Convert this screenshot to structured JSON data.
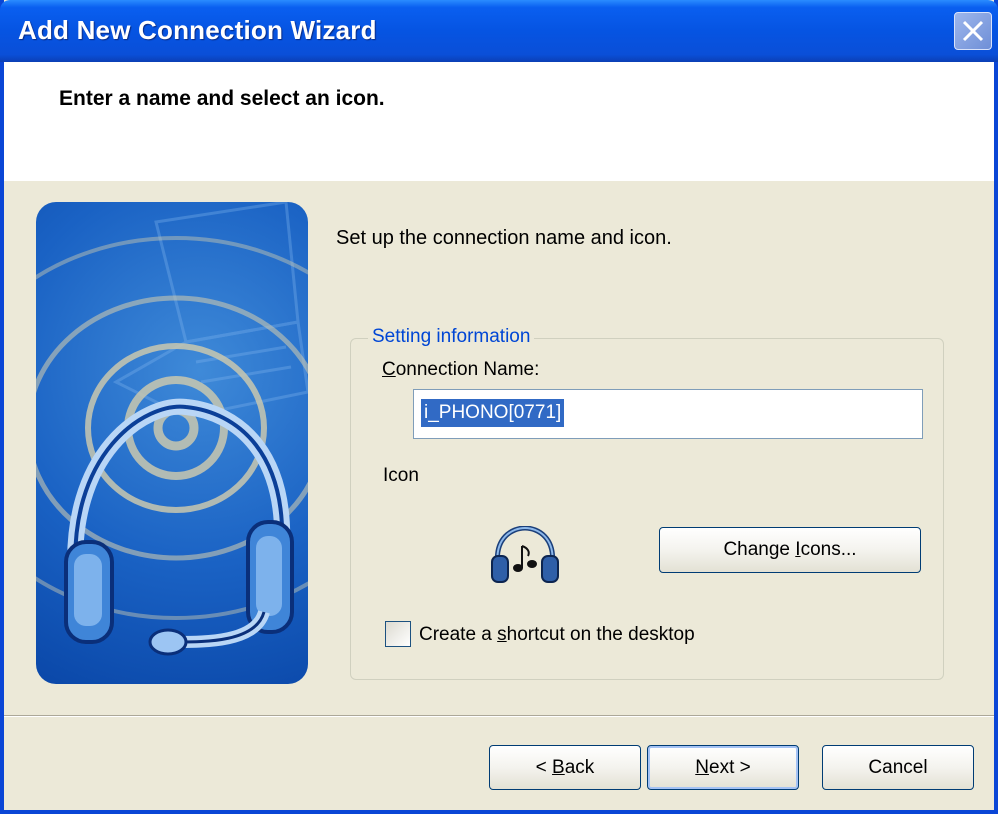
{
  "window": {
    "title": "Add New Connection Wizard"
  },
  "header": {
    "title": "Enter a name and select an icon."
  },
  "content": {
    "intro": "Set up the connection name and icon.",
    "group_legend": "Setting information",
    "connection_name_label_prefix": "C",
    "connection_name_label_rest": "onnection Name:",
    "connection_name_value": "i_PHONO[0771]",
    "icon_label": "Icon",
    "icon_name": "headphones-music-icon",
    "change_icons_before": "Change ",
    "change_icons_mnemonic": "I",
    "change_icons_after": "cons...",
    "shortcut_checked": false,
    "shortcut_before": "Create a ",
    "shortcut_mnemonic": "s",
    "shortcut_after": "hortcut on the desktop"
  },
  "footer": {
    "back_prefix": "< ",
    "back_mnemonic": "B",
    "back_rest": "ack",
    "next_mnemonic": "N",
    "next_rest": "ext >",
    "cancel": "Cancel"
  },
  "colors": {
    "titlebar": "#0654e2",
    "dialog_bg": "#ece9d8",
    "legend_text": "#0046d5",
    "selection": "#316ac5"
  }
}
